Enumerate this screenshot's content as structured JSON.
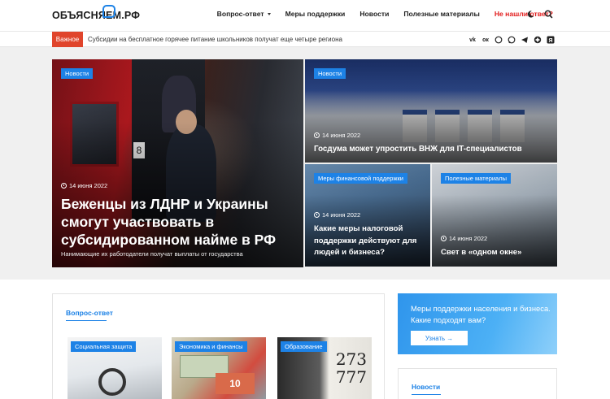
{
  "header": {
    "logo_text": "ОБЪЯСНЯЕМ.РФ",
    "nav": [
      {
        "label": "Вопрос-ответ",
        "has_dropdown": true
      },
      {
        "label": "Меры поддержки"
      },
      {
        "label": "Новости"
      },
      {
        "label": "Полезные материалы"
      },
      {
        "label": "Не нашли ответ?",
        "color": "#e21d1d"
      }
    ],
    "icons": [
      "moon-icon",
      "search-icon"
    ]
  },
  "ticker": {
    "badge": "Важное",
    "text": "Субсидии на бесплатное горячее питание школьников получат еще четыре региона",
    "socials": [
      "vk-icon",
      "odnoklassniki-icon",
      "viber-icon",
      "whatsapp-icon",
      "telegram-icon",
      "dzen-icon",
      "yandex-icon"
    ]
  },
  "hero": {
    "main": {
      "tag": "Новости",
      "date": "14 июня 2022",
      "title": "Беженцы из ЛДНР и Украины смогут участвовать в субсидированном найме в РФ",
      "subtitle": "Нанимающие их работодатели получат выплаты от государства"
    },
    "top_right": {
      "tag": "Новости",
      "date": "14 июня 2022",
      "title": "Госдума может упростить ВНЖ для IT-специалистов"
    },
    "bottom_mid": {
      "tag": "Меры финансовой поддержки",
      "date": "14 июня 2022",
      "title": "Какие меры налоговой поддержки действуют для людей и бизнеса?"
    },
    "bottom_right": {
      "tag": "Полезные материалы",
      "date": "14 июня 2022",
      "title": "Свет в «одном окне»"
    }
  },
  "qa": {
    "title": "Вопрос-ответ",
    "cards": [
      {
        "tag": "Социальная защита"
      },
      {
        "tag": "Экономика и финансы",
        "bill_value": "10"
      },
      {
        "tag": "Образование",
        "digits": "273\n777"
      }
    ]
  },
  "promo": {
    "text": "Меры поддержки населения и бизнеса. Какие подходят вам?",
    "button": "Узнать →"
  },
  "news": {
    "title": "Новости"
  },
  "colors": {
    "accent": "#1d82e6",
    "alert": "#e21d1d",
    "badge": "#e0452c"
  }
}
